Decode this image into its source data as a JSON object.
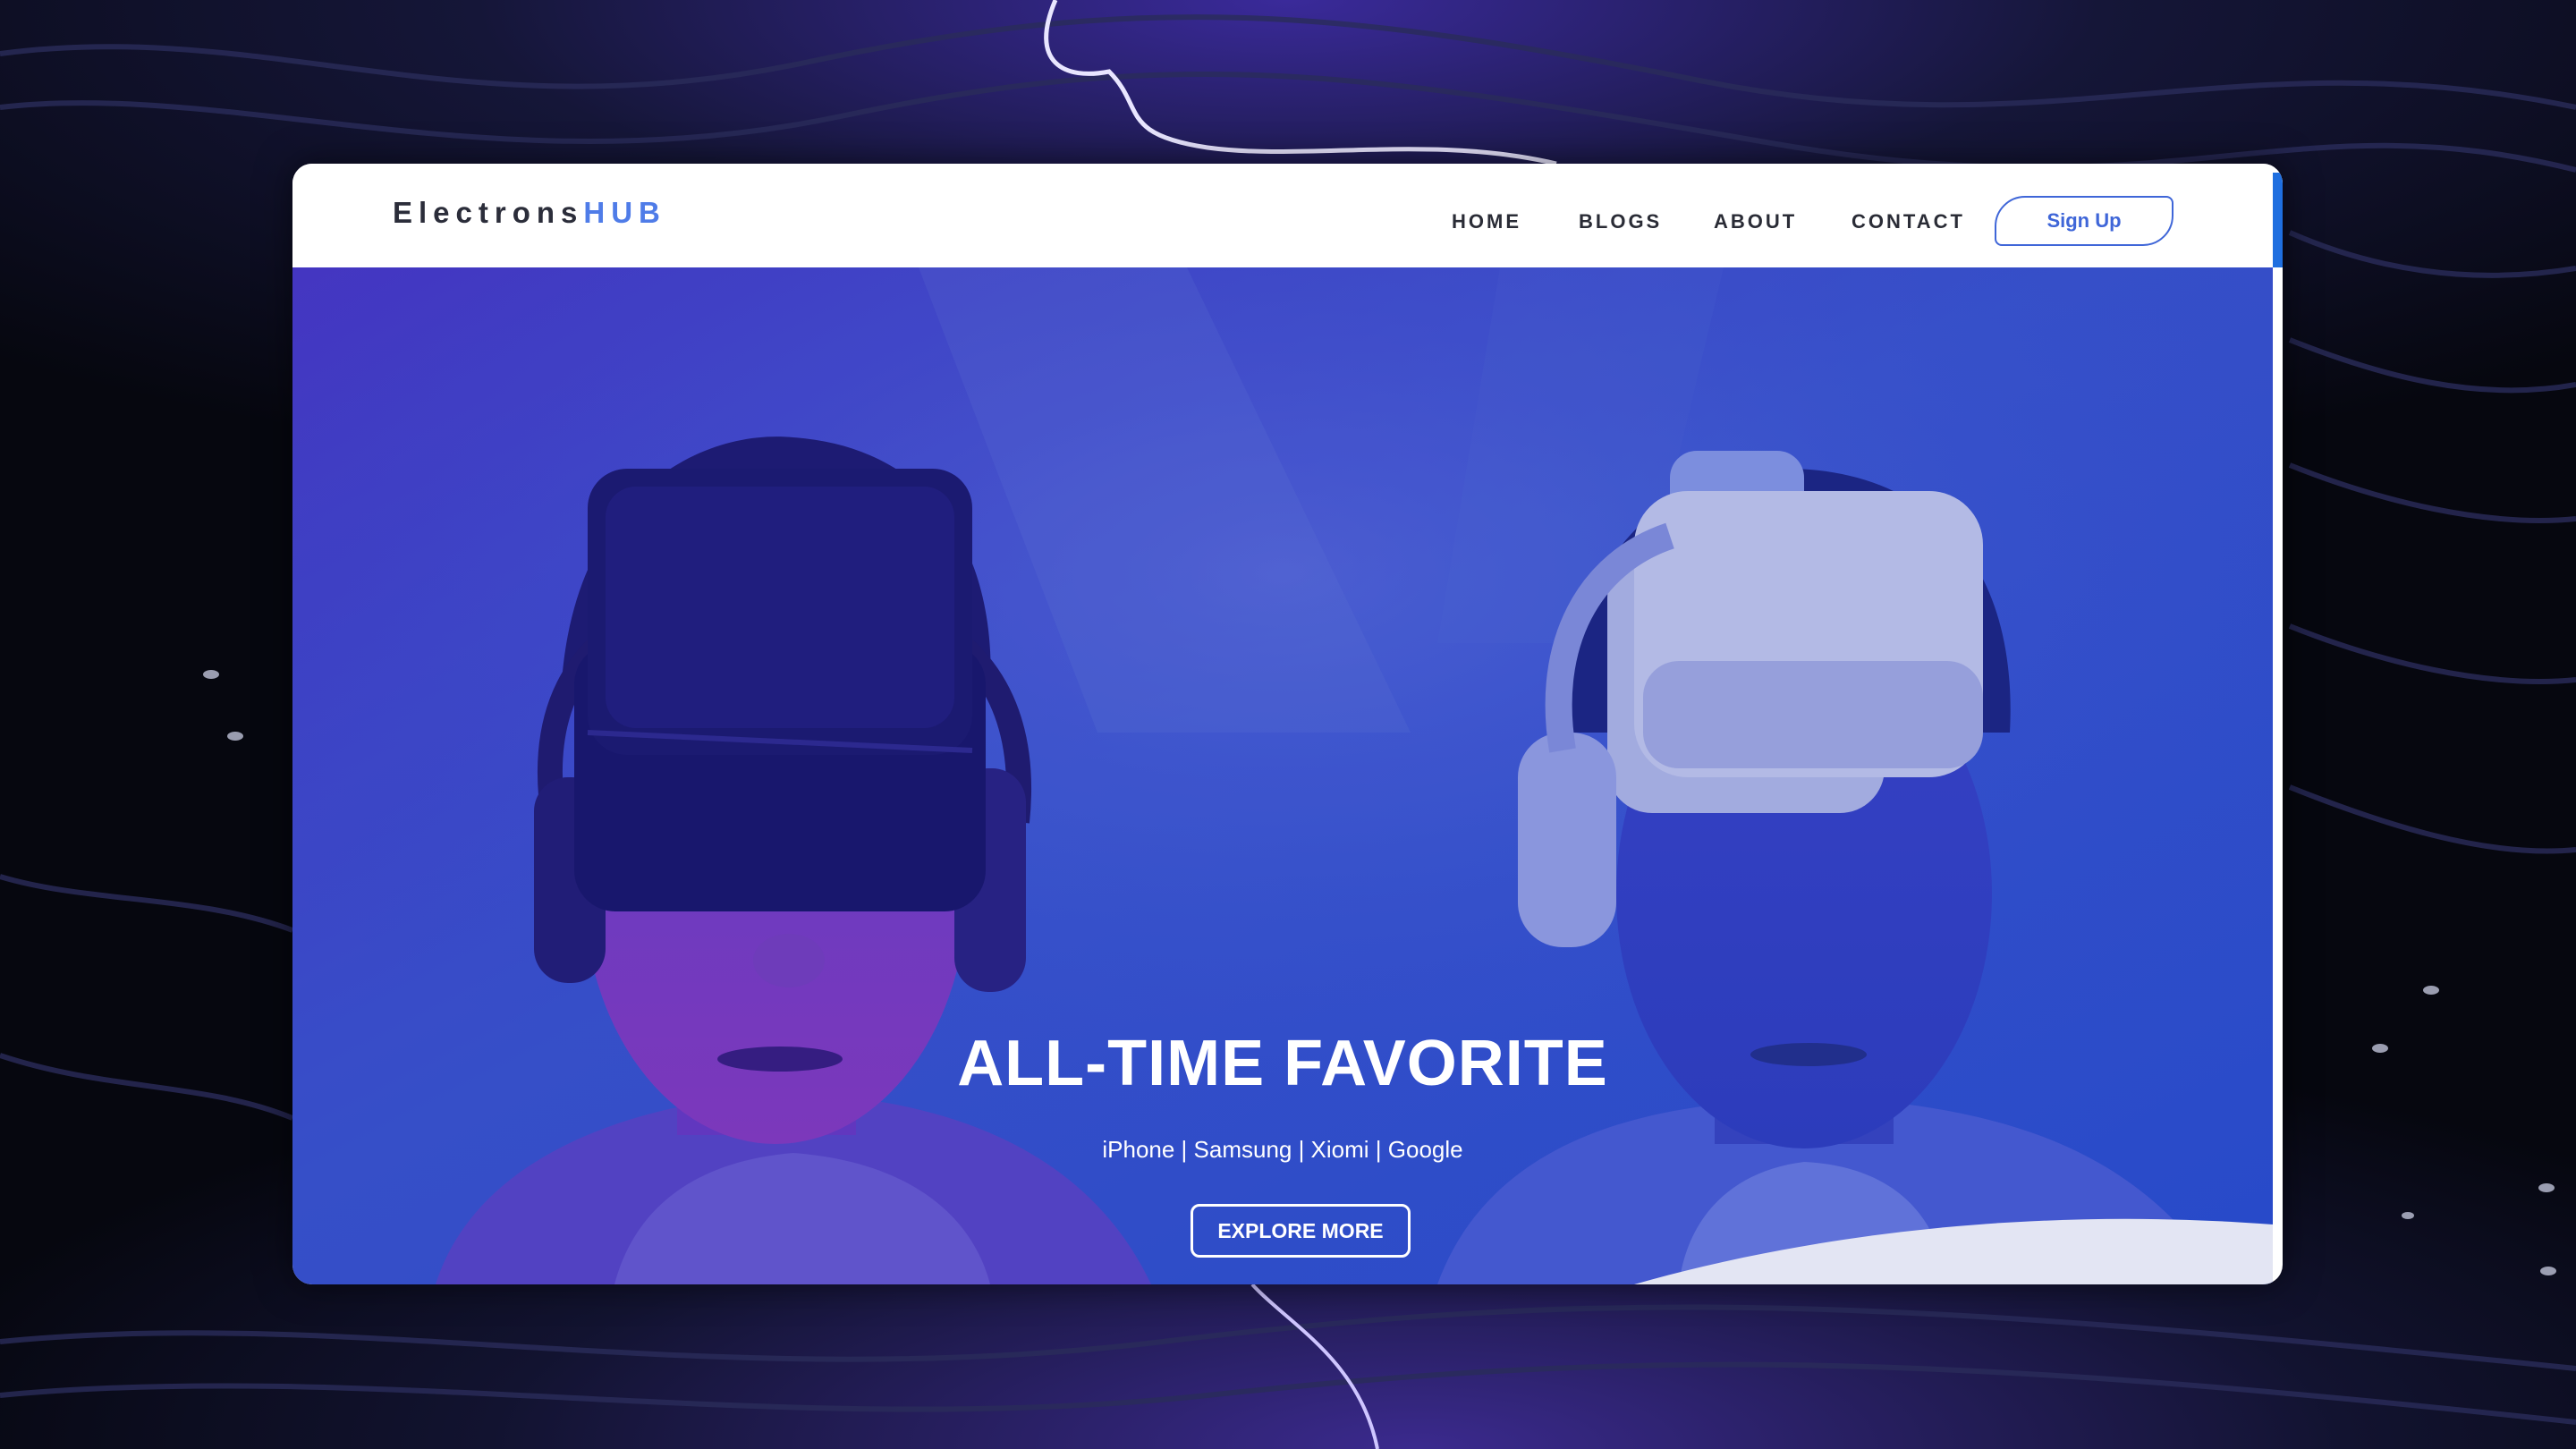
{
  "brand": {
    "name_part1": "Electrons",
    "name_part2": "HUB"
  },
  "nav": {
    "items": [
      "HOME",
      "BLOGS",
      "ABOUT",
      "CONTACT"
    ]
  },
  "signup_label": "Sign Up",
  "hero": {
    "title": "ALL-TIME FAVORITE",
    "subtitle": "iPhone | Samsung | Xiomi | Google",
    "cta_label": "EXPLORE MORE"
  },
  "colors": {
    "accent": "#4f7ce8",
    "hero_blue": "#2b4fd0",
    "hero_violet": "#5a2fc4",
    "backdrop": "#0b0d1f"
  },
  "icons": [
    "vr-headset-icon",
    "headphones-icon"
  ]
}
